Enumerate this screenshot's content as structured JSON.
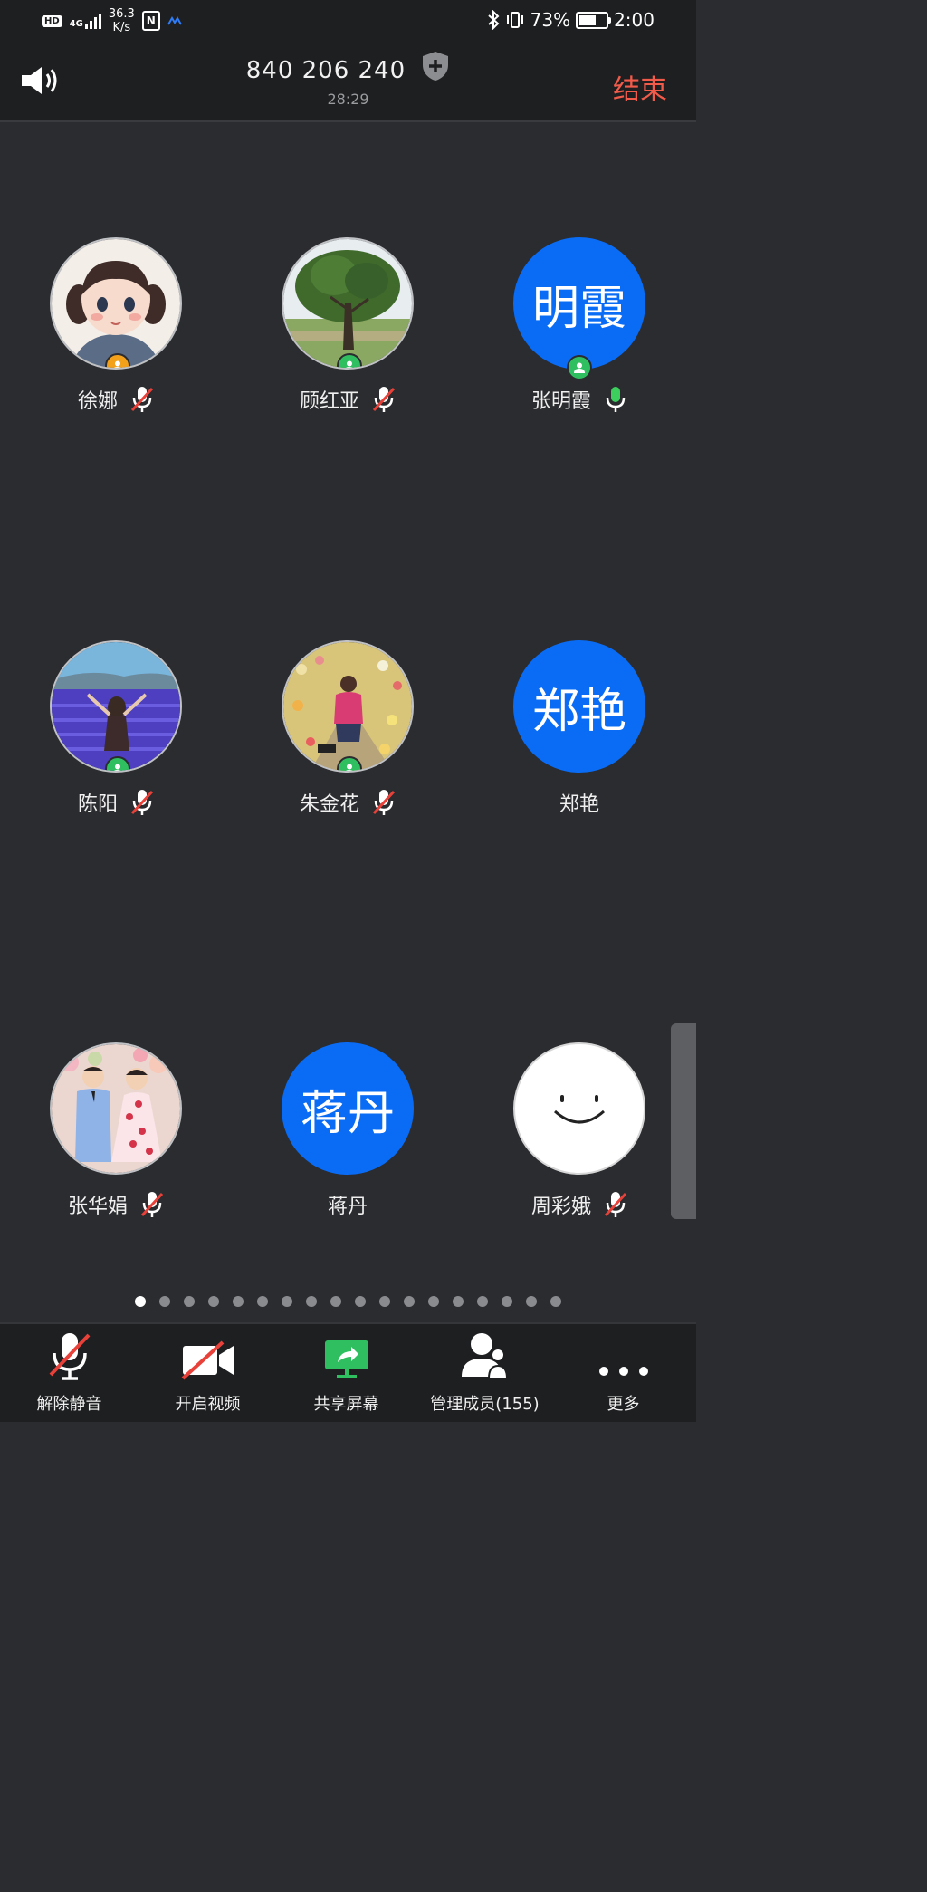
{
  "status_bar": {
    "hd": "HD",
    "network": "4G",
    "speed_value": "36.3",
    "speed_unit": "K/s",
    "nfc": "N",
    "battery_percent": "73%",
    "battery_level": 0.73,
    "time": "2:00"
  },
  "header": {
    "meeting_id": "840 206 240",
    "duration": "28:29",
    "end_label": "结束"
  },
  "participants": [
    {
      "name": "徐娜",
      "avatar": "photo-girl-illustration",
      "badge": "orange",
      "mic": "muted"
    },
    {
      "name": "顾红亚",
      "avatar": "photo-tree",
      "badge": "green",
      "mic": "muted"
    },
    {
      "name": "张明霞",
      "avatar_text": "明霞",
      "avatar": "initials",
      "badge": "green",
      "mic": "active"
    },
    {
      "name": "陈阳",
      "avatar": "photo-lavender-field",
      "badge": "green",
      "mic": "muted"
    },
    {
      "name": "朱金花",
      "avatar": "photo-flower-field",
      "badge": "green",
      "mic": "muted"
    },
    {
      "name": "郑艳",
      "avatar_text": "郑艳",
      "avatar": "initials",
      "badge": "none",
      "mic": "none"
    },
    {
      "name": "张华娟",
      "avatar": "photo-children",
      "badge": "none",
      "mic": "muted"
    },
    {
      "name": "蒋丹",
      "avatar_text": "蒋丹",
      "avatar": "initials",
      "badge": "none",
      "mic": "none"
    },
    {
      "name": "周彩娥",
      "avatar": "smiley",
      "badge": "none",
      "mic": "muted"
    }
  ],
  "pager": {
    "total": 18,
    "current": 1
  },
  "toolbar": {
    "unmute": "解除静音",
    "start_video": "开启视频",
    "share_screen": "共享屏幕",
    "manage_members": "管理成员(155)",
    "more": "更多"
  },
  "colors": {
    "background": "#2b2c2f",
    "bar": "#1e1f21",
    "avatar_blue": "#0a6cf5",
    "end_red": "#f15b4a",
    "badge_green": "#2fbf60",
    "badge_orange": "#f3a01a",
    "mic_green": "#3ccf5e",
    "mute_red": "#e8413a"
  }
}
